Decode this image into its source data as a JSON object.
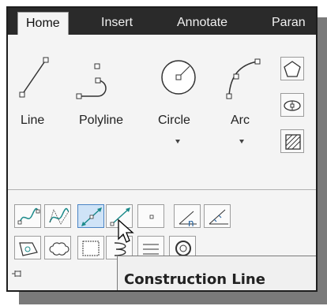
{
  "ribbon": {
    "tabs": [
      {
        "label": "Home"
      },
      {
        "label": "Insert"
      },
      {
        "label": "Annotate"
      },
      {
        "label": "Paran"
      }
    ],
    "active_tab": "Home",
    "draw_panel": {
      "big_tools": [
        {
          "label": "Line",
          "icon": "line-icon",
          "has_dropdown": false
        },
        {
          "label": "Polyline",
          "icon": "polyline-icon",
          "has_dropdown": false
        },
        {
          "label": "Circle",
          "icon": "circle-icon",
          "has_dropdown": true
        },
        {
          "label": "Arc",
          "icon": "arc-icon",
          "has_dropdown": true
        }
      ],
      "side_tools": [
        {
          "icon": "polygon-icon"
        },
        {
          "icon": "ellipse-icon"
        },
        {
          "icon": "hatch-icon"
        }
      ]
    },
    "expanded_tools": {
      "row1": [
        {
          "icon": "spline-fit-icon"
        },
        {
          "icon": "spline-cv-icon"
        },
        {
          "icon": "construction-line-icon",
          "highlighted": true
        },
        {
          "icon": "ray-icon"
        },
        {
          "icon": "point-icon"
        },
        {
          "icon": "divide-icon"
        },
        {
          "icon": "measure-icon"
        }
      ],
      "row2": [
        {
          "icon": "region-icon"
        },
        {
          "icon": "revision-cloud-icon"
        },
        {
          "icon": "wipeout-icon"
        },
        {
          "icon": "helix-icon"
        },
        {
          "icon": "boundary-icon"
        },
        {
          "icon": "donut-icon"
        }
      ]
    }
  },
  "tooltip": {
    "title": "Construction Line"
  },
  "colors": {
    "tab_bar": "#2a2a2a",
    "highlight": "#cfe3f7",
    "highlight_border": "#4a84c4",
    "icon_teal": "#1a8a8a"
  }
}
